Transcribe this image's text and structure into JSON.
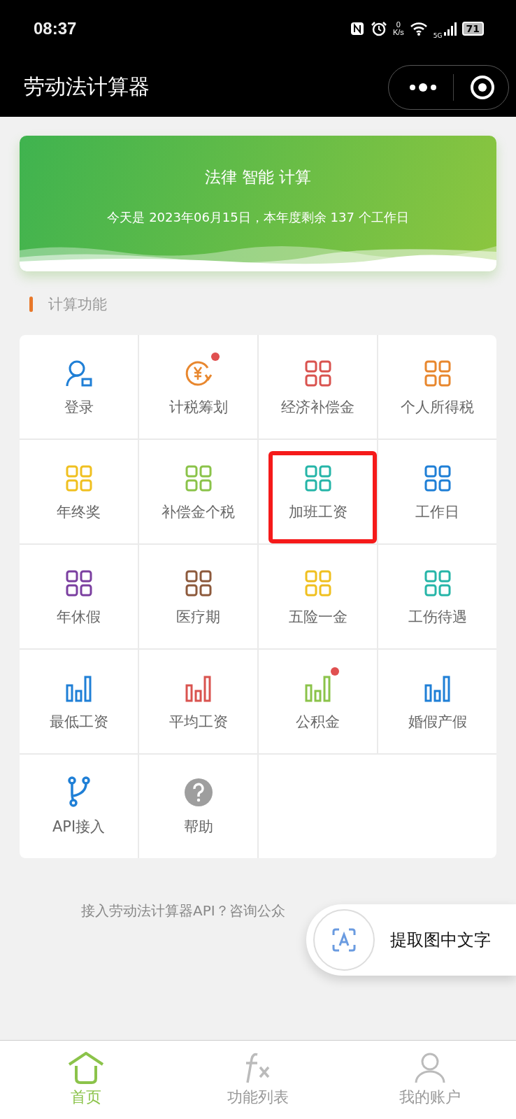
{
  "status_bar": {
    "time": "08:37",
    "net_speed_value": "0",
    "net_speed_unit": "K/s",
    "network": "5G",
    "battery": "71"
  },
  "app_bar": {
    "title": "劳动法计算器"
  },
  "banner": {
    "title": "法律 智能 计算",
    "subtitle": "今天是 2023年06月15日，本年度剩余 137 个工作日"
  },
  "section": {
    "title": "计算功能"
  },
  "grid": [
    {
      "label": "登录",
      "kind": "person",
      "color": "#1f7fd6",
      "badge": false,
      "highlighted": false
    },
    {
      "label": "计税筹划",
      "kind": "yen",
      "color": "#e8872e",
      "badge": true,
      "highlighted": false
    },
    {
      "label": "经济补偿金",
      "kind": "grid",
      "color": "#d9534f",
      "badge": false,
      "highlighted": false
    },
    {
      "label": "个人所得税",
      "kind": "grid",
      "color": "#e8872e",
      "badge": false,
      "highlighted": false
    },
    {
      "label": "年终奖",
      "kind": "grid",
      "color": "#f0c020",
      "badge": false,
      "highlighted": false
    },
    {
      "label": "补偿金个税",
      "kind": "grid",
      "color": "#8bc34a",
      "badge": false,
      "highlighted": false
    },
    {
      "label": "加班工资",
      "kind": "grid",
      "color": "#26b5a8",
      "badge": false,
      "highlighted": true
    },
    {
      "label": "工作日",
      "kind": "grid",
      "color": "#1f7fd6",
      "badge": false,
      "highlighted": false
    },
    {
      "label": "年休假",
      "kind": "grid",
      "color": "#7b3fa0",
      "badge": false,
      "highlighted": false
    },
    {
      "label": "医疗期",
      "kind": "grid",
      "color": "#8d5a3c",
      "badge": false,
      "highlighted": false
    },
    {
      "label": "五险一金",
      "kind": "grid",
      "color": "#f0c020",
      "badge": false,
      "highlighted": false
    },
    {
      "label": "工伤待遇",
      "kind": "grid",
      "color": "#26b5a8",
      "badge": false,
      "highlighted": false
    },
    {
      "label": "最低工资",
      "kind": "bars",
      "color": "#1f7fd6",
      "badge": false,
      "highlighted": false
    },
    {
      "label": "平均工资",
      "kind": "bars",
      "color": "#d9534f",
      "badge": false,
      "highlighted": false
    },
    {
      "label": "公积金",
      "kind": "bars",
      "color": "#8bc34a",
      "badge": true,
      "highlighted": false
    },
    {
      "label": "婚假产假",
      "kind": "bars",
      "color": "#1f7fd6",
      "badge": false,
      "highlighted": false
    },
    {
      "label": "API接入",
      "kind": "branch",
      "color": "#1f7fd6",
      "badge": false,
      "highlighted": false
    },
    {
      "label": "帮助",
      "kind": "help",
      "color": "#9e9e9e",
      "badge": false,
      "highlighted": false
    }
  ],
  "footer_note": "接入劳动法计算器API？咨询公众",
  "float_button": {
    "label": "提取图中文字"
  },
  "tabs": [
    {
      "label": "首页",
      "kind": "home",
      "selected": true
    },
    {
      "label": "功能列表",
      "kind": "fx",
      "selected": false
    },
    {
      "label": "我的账户",
      "kind": "user",
      "selected": false
    }
  ]
}
